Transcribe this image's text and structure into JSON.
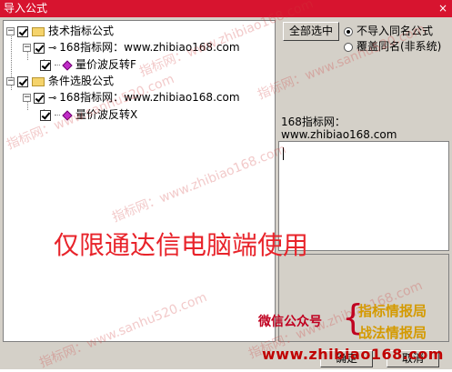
{
  "window": {
    "title": "导入公式",
    "close_glyph": "×"
  },
  "tree": {
    "root1": {
      "label": "技术指标公式",
      "expander": "−"
    },
    "root1_child": {
      "label": "168指标网：www.zhibiao168.com",
      "expander": "−"
    },
    "root1_leaf": {
      "label": "量价波反转F"
    },
    "root2": {
      "label": "条件选股公式",
      "expander": "−"
    },
    "root2_child": {
      "label": "168指标网：www.zhibiao168.com",
      "expander": "−"
    },
    "root2_leaf": {
      "label": "量价波反转X"
    }
  },
  "actions": {
    "select_all": "全部选中",
    "radio_skip": "不导入同名公式",
    "radio_overwrite": "覆盖同名(非系统)",
    "ok": "确定",
    "cancel": "取消"
  },
  "info": {
    "label": "168指标网：www.zhibiao168.com"
  },
  "overlay": {
    "banner": "仅限通达信电脑端使用",
    "wechat": "微信公众号",
    "brace": "{",
    "promo1": "指标情报局",
    "promo2": "战法情报局",
    "url": "www.zhibiao168.com",
    "watermarks": [
      "指标网：www.sanhu520.com",
      "指标网：www.zhibiao168.com"
    ]
  },
  "colors": {
    "titlebar": "#d7142f",
    "banner": "#e8232a",
    "promo": "#d49a00"
  },
  "icons": {
    "folder": "folder-icon",
    "key": "key-icon",
    "formula": "formula-icon"
  }
}
